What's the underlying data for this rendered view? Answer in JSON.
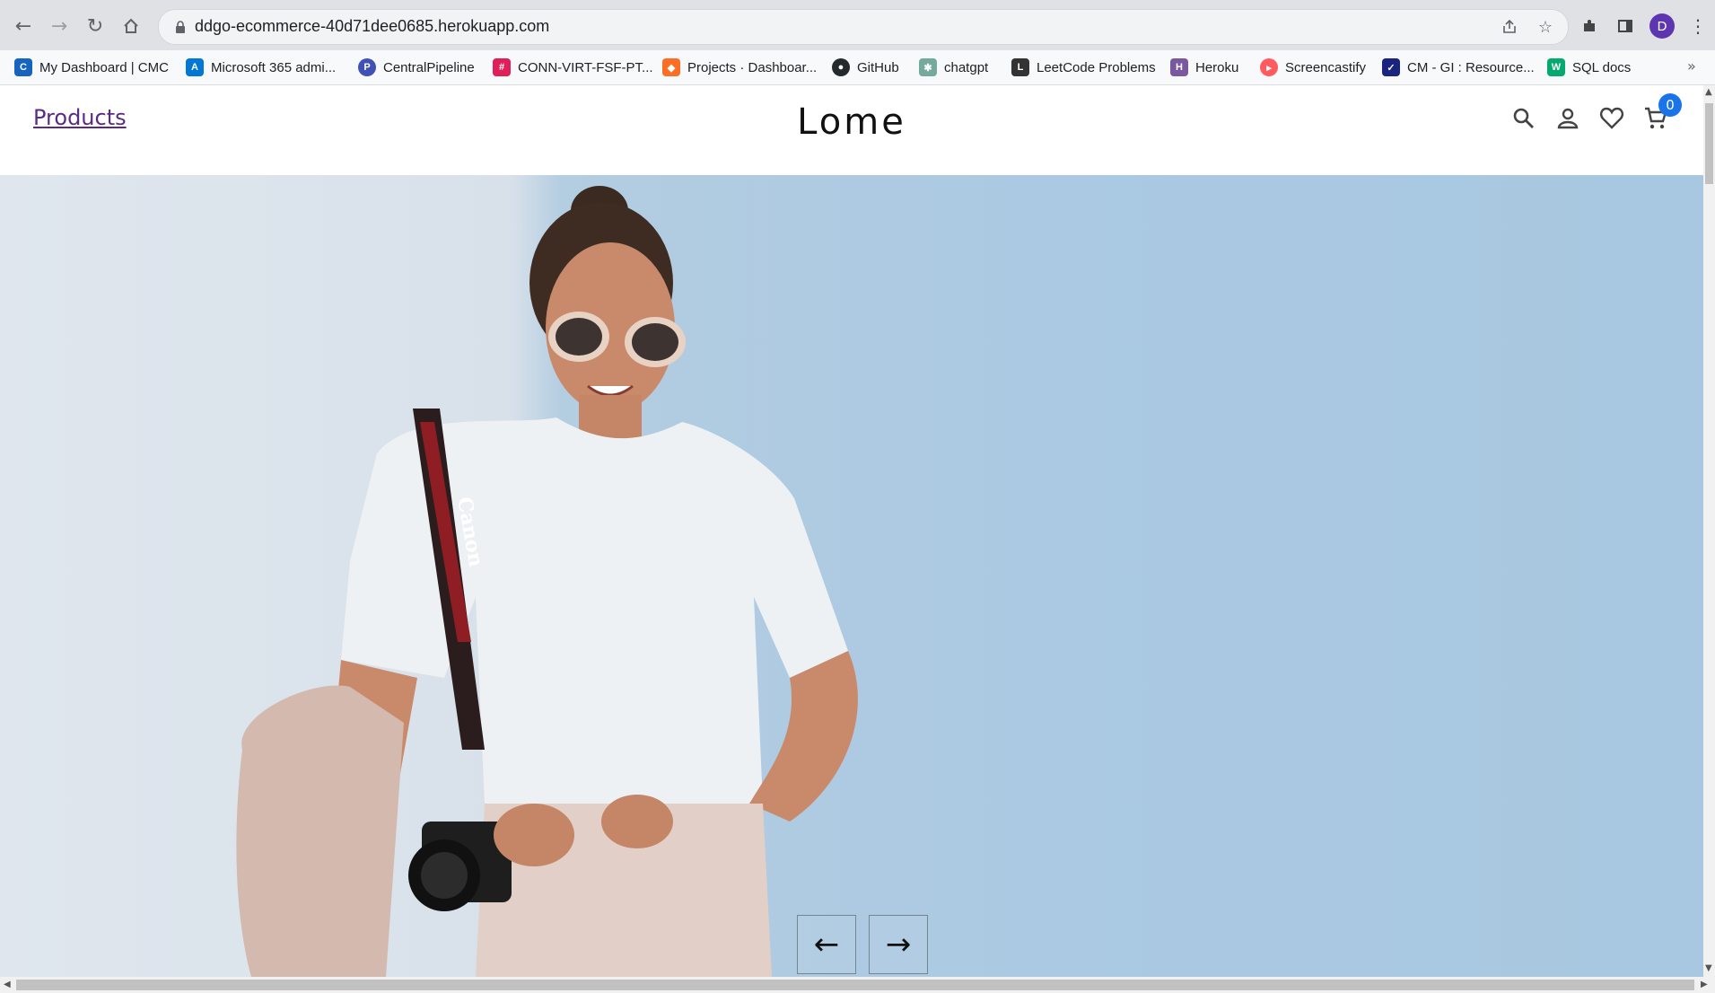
{
  "browser": {
    "url": "ddgo-ecommerce-40d71dee0685.herokuapp.com",
    "profile_initial": "D",
    "bookmarks": [
      {
        "label": "My Dashboard | CMC",
        "icon": "cmc-icon",
        "color": "#1565c0"
      },
      {
        "label": "Microsoft 365 admi...",
        "icon": "microsoft-365-icon",
        "color": "#0078d4"
      },
      {
        "label": "CentralPipeline",
        "icon": "centralpipeline-icon",
        "color": "#3f51b5"
      },
      {
        "label": "CONN-VIRT-FSF-PT...",
        "icon": "slack-icon",
        "color": "#e01e5a"
      },
      {
        "label": "Projects · Dashboar...",
        "icon": "gitlab-icon",
        "color": "#fc6d26"
      },
      {
        "label": "GitHub",
        "icon": "github-icon",
        "color": "#24292e"
      },
      {
        "label": "chatgpt",
        "icon": "chatgpt-icon",
        "color": "#74aa9c"
      },
      {
        "label": "LeetCode Problems",
        "icon": "leetcode-icon",
        "color": "#333333"
      },
      {
        "label": "Heroku",
        "icon": "heroku-icon",
        "color": "#79589f"
      },
      {
        "label": "Screencastify",
        "icon": "screencastify-icon",
        "color": "#ff5a5f"
      },
      {
        "label": "CM - GI : Resource...",
        "icon": "cm-gi-icon",
        "color": "#1a237e"
      },
      {
        "label": "SQL docs",
        "icon": "w3schools-icon",
        "color": "#04aa6d"
      }
    ],
    "bookmarks_more": "»"
  },
  "site": {
    "nav_link": "Products",
    "brand": "Lome",
    "cart_count": "0"
  },
  "hero": {
    "prev_arrow": "←",
    "next_arrow": "→",
    "strap_text": "Canon"
  }
}
